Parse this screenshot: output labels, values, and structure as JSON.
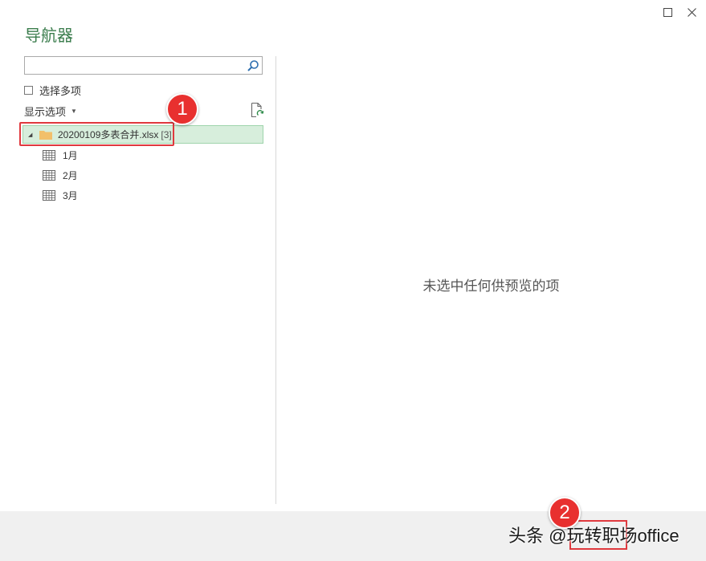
{
  "window": {
    "title": "导航器",
    "maximize_icon": "maximize-icon",
    "close_icon": "close-icon"
  },
  "search": {
    "value": "",
    "placeholder": ""
  },
  "select_multiple": {
    "label": "选择多项",
    "checked": false
  },
  "display_options": {
    "label": "显示选项"
  },
  "tree": {
    "root": {
      "label": "20200109多表合并.xlsx",
      "count": "[3]",
      "expanded": true,
      "selected": true
    },
    "items": [
      {
        "label": "1月"
      },
      {
        "label": "2月"
      },
      {
        "label": "3月"
      }
    ]
  },
  "preview": {
    "empty_message": "未选中任何供预览的项"
  },
  "annotations": {
    "badge1": "1",
    "badge2": "2"
  },
  "watermark": "头条 @玩转职场office",
  "colors": {
    "title": "#3b7d4d",
    "selection_bg": "#d7eedc",
    "annotation": "#e8302f",
    "footer_bg": "#f0f0f0"
  }
}
